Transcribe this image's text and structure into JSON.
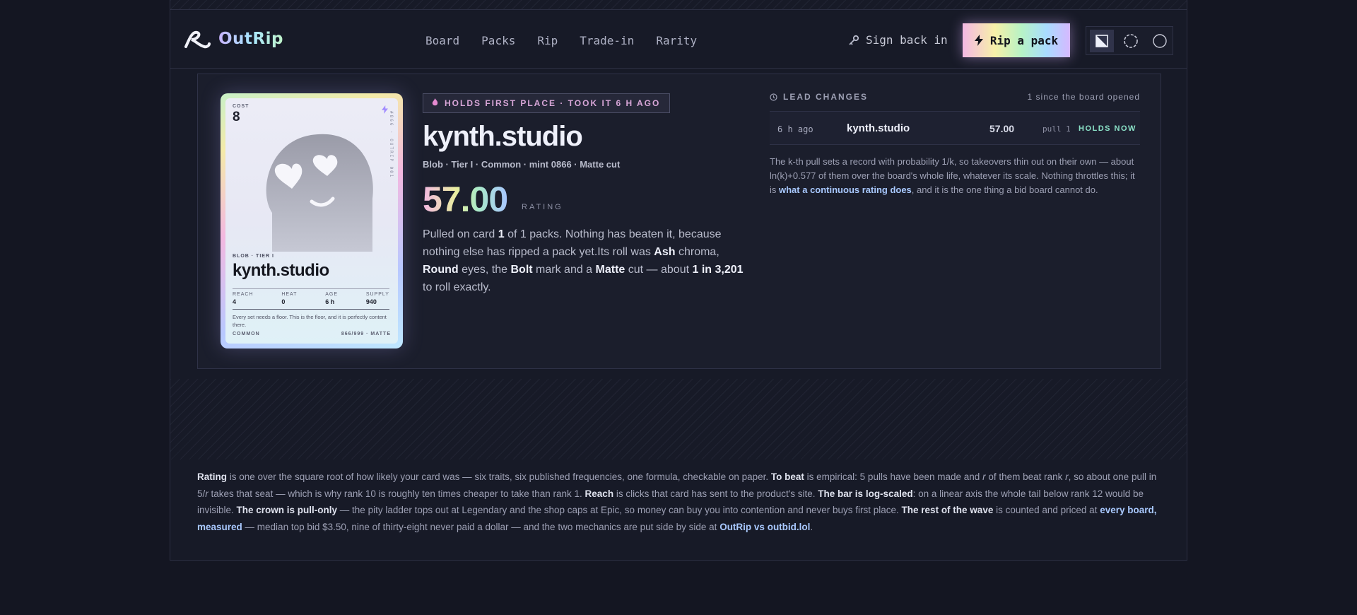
{
  "brand": {
    "name": "OutRip"
  },
  "nav": {
    "items": [
      "Board",
      "Packs",
      "Rip",
      "Trade-in",
      "Rarity"
    ]
  },
  "header": {
    "signin_label": "Sign back in",
    "rip_label": "Rip a pack"
  },
  "card": {
    "cost_label": "COST",
    "cost_value": "8",
    "side_text": "#866 · OUTRIP 001",
    "kind": "BLOB · TIER I",
    "name": "kynth.studio",
    "stats": [
      {
        "label": "REACH",
        "value": "4"
      },
      {
        "label": "HEAT",
        "value": "0"
      },
      {
        "label": "AGE",
        "value": "6 h"
      },
      {
        "label": "SUPPLY",
        "value": "940"
      }
    ],
    "flavor": "Every set needs a floor. This is the floor, and it is perfectly content there.",
    "foot_left": "COMMON",
    "foot_right": "866/999 · MATTE"
  },
  "leader": {
    "badge": "HOLDS FIRST PLACE · TOOK IT 6 H AGO",
    "title": "kynth.studio",
    "meta": "Blob · Tier I · Common · mint 0866 · Matte cut",
    "rating_value": "57.00",
    "rating_label": "RATING",
    "desc": {
      "p1": "Pulled on card ",
      "b1": "1",
      "p2": " of 1 packs. Nothing has beaten it, because nothing else has ripped a pack yet.Its roll was ",
      "b2": "Ash",
      "p3": " chroma, ",
      "b3": "Round",
      "p4": " eyes, the ",
      "b4": "Bolt",
      "p5": " mark and a ",
      "b5": "Matte",
      "p6": " cut — about ",
      "b6": "1 in 3,201",
      "p7": " to roll exactly."
    }
  },
  "lead_changes": {
    "title": "LEAD CHANGES",
    "count": "1 since the board opened",
    "rows": [
      {
        "time": "6 h ago",
        "name": "kynth.studio",
        "value": "57.00",
        "pull": "pull 1",
        "status": "HOLDS NOW"
      }
    ],
    "note_text": "The k-th pull sets a record with probability 1/k, so takeovers thin out on their own — about ln(k)+0.577 of them over the board's whole life, whatever its scale. Nothing throttles this; it is ",
    "note_link": "what a continuous rating does",
    "note_end": ", and it is the one thing a bid board cannot do."
  },
  "footer": {
    "b1": "Rating",
    "t1": " is one over the square root of how likely your card was — six traits, six published frequencies, one formula, checkable on paper. ",
    "b2": "To beat",
    "t2": " is empirical: 5 pulls have been made and ",
    "i1": "r",
    "t3": " of them beat rank ",
    "i2": "r",
    "t4": ", so about one pull in 5/",
    "i3": "r",
    "t5": " takes that seat — which is why rank 10 is roughly ten times cheaper to take than rank 1. ",
    "b3": "Reach",
    "t6": " is clicks that card has sent to the product's site. ",
    "b4": "The bar is log-scaled",
    "t7": ": on a linear axis the whole tail below rank 12 would be invisible. ",
    "b5": "The crown is pull-only",
    "t8": " — the pity ladder tops out at Legendary and the shop caps at Epic, so money can buy you into contention and never buys first place. ",
    "b6": "The rest of the wave",
    "t9": " is counted and priced at ",
    "l1": "every board, measured",
    "t10": " — median top bid $3.50, nine of thirty-eight never paid a dollar — and the two mechanics are put side by side at ",
    "l2": "OutRip vs outbid.lol",
    "t11": "."
  },
  "colors": {
    "accent_link": "#a9c9ff",
    "holds": "#8be2c8",
    "badge": "#d8a6d8"
  }
}
